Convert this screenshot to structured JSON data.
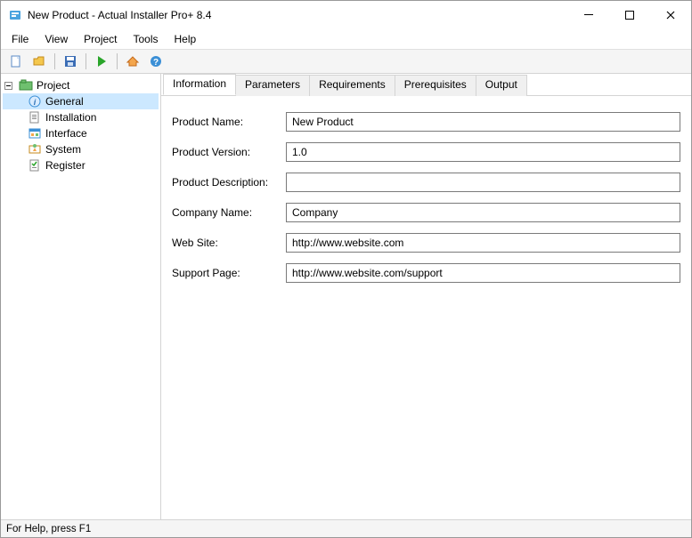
{
  "window": {
    "title": "New Product - Actual Installer Pro+ 8.4"
  },
  "menubar": {
    "items": [
      "File",
      "View",
      "Project",
      "Tools",
      "Help"
    ]
  },
  "sidebar": {
    "root": "Project",
    "items": [
      {
        "label": "General",
        "icon": "info-icon",
        "selected": true
      },
      {
        "label": "Installation",
        "icon": "document-icon",
        "selected": false
      },
      {
        "label": "Interface",
        "icon": "interface-icon",
        "selected": false
      },
      {
        "label": "System",
        "icon": "system-icon",
        "selected": false
      },
      {
        "label": "Register",
        "icon": "register-icon",
        "selected": false
      }
    ]
  },
  "tabs": {
    "items": [
      "Information",
      "Parameters",
      "Requirements",
      "Prerequisites",
      "Output"
    ],
    "active": 0
  },
  "form": {
    "fields": [
      {
        "label": "Product Name:",
        "value": "New Product"
      },
      {
        "label": "Product Version:",
        "value": "1.0"
      },
      {
        "label": "Product Description:",
        "value": ""
      },
      {
        "label": "Company Name:",
        "value": "Company"
      },
      {
        "label": "Web Site:",
        "value": "http://www.website.com"
      },
      {
        "label": "Support Page:",
        "value": "http://www.website.com/support"
      }
    ]
  },
  "statusbar": {
    "text": "For Help, press F1"
  }
}
